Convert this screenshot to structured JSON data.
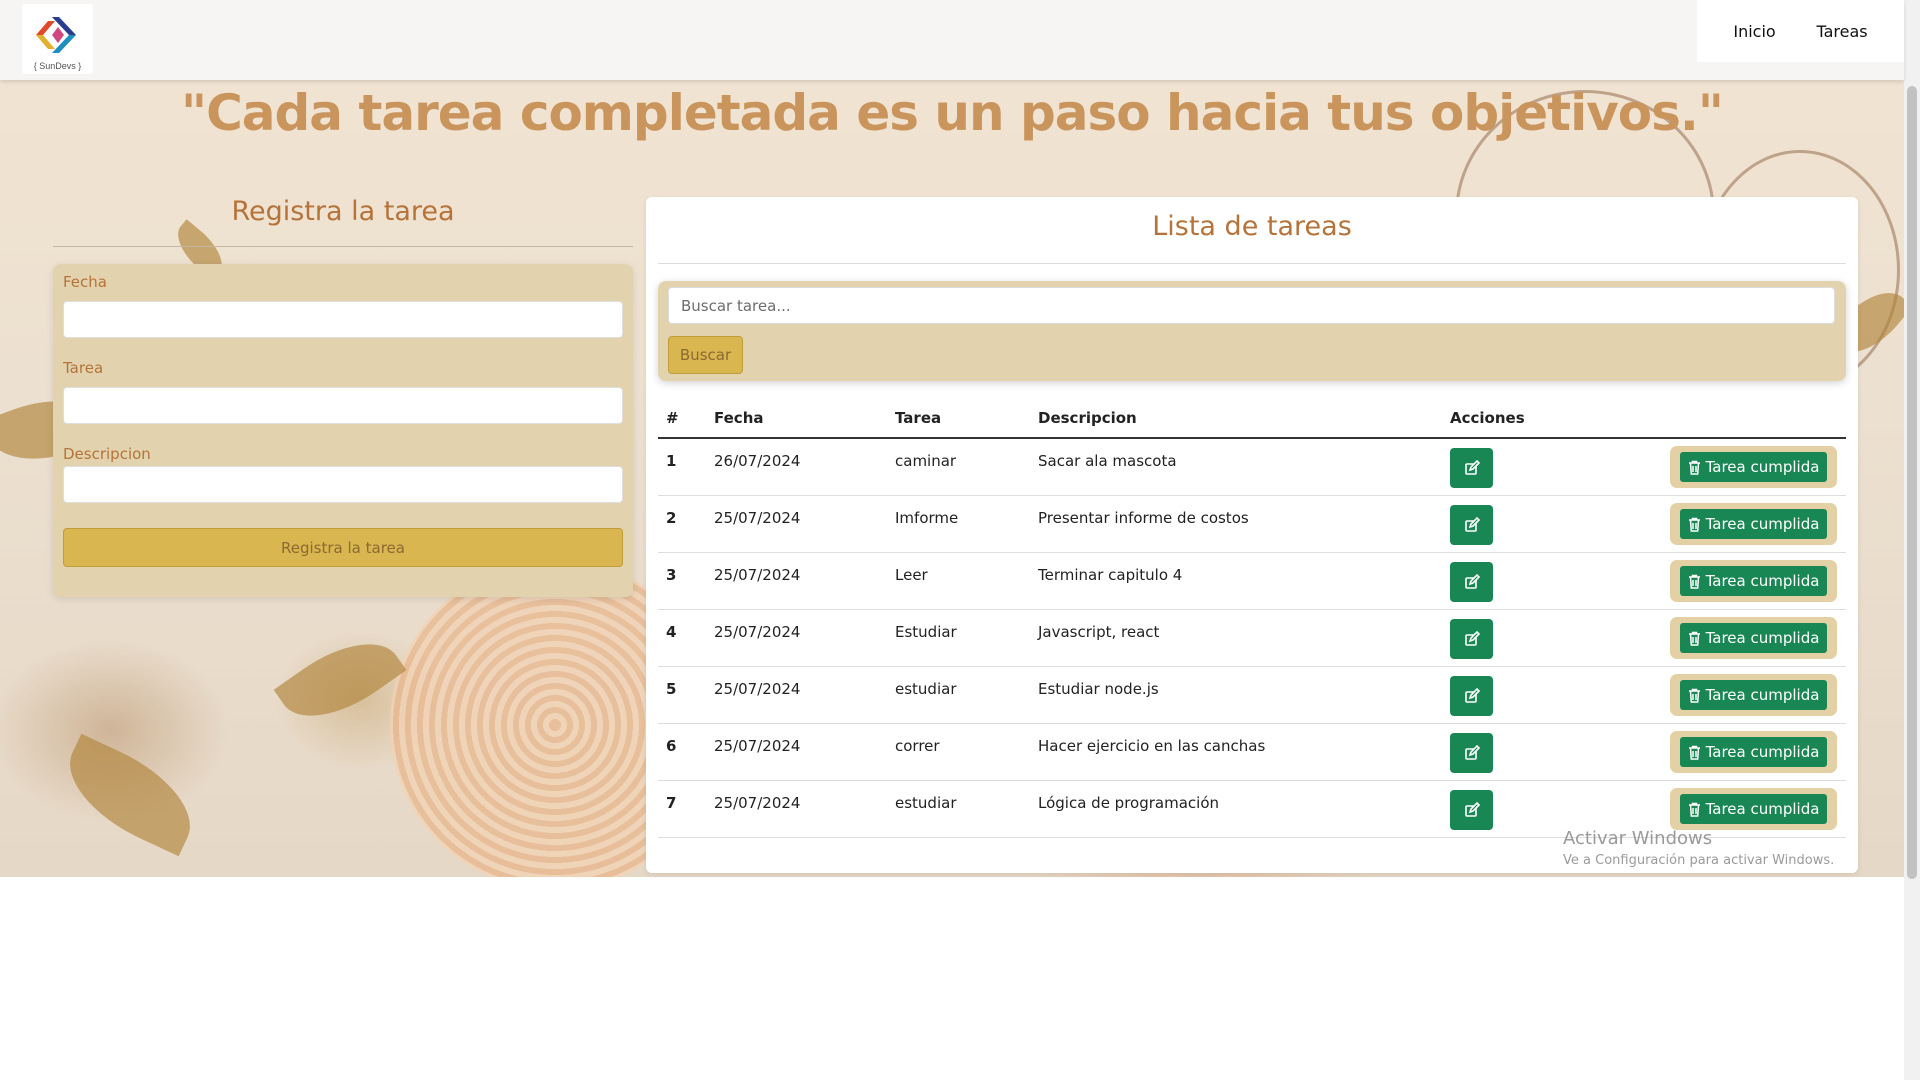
{
  "navbar": {
    "logo_text": "{ SunDevs }",
    "links": [
      "Inicio",
      "Tareas"
    ]
  },
  "hero": {
    "quote": "\"Cada tarea completada es un paso hacia tus objetivos.\""
  },
  "form": {
    "title": "Registra la tarea",
    "fields": [
      {
        "label": "Fecha",
        "value": ""
      },
      {
        "label": "Tarea",
        "value": ""
      },
      {
        "label": "Descripcion",
        "value": ""
      }
    ],
    "submit_label": "Registra la tarea"
  },
  "list": {
    "title": "Lista de tareas",
    "search_placeholder": "Buscar tarea...",
    "search_button": "Buscar",
    "columns": [
      "#",
      "Fecha",
      "Tarea",
      "Descripcion",
      "Acciones"
    ],
    "rows": [
      {
        "num": "1",
        "date": "26/07/2024",
        "task": "caminar",
        "desc": "Sacar ala mascota"
      },
      {
        "num": "2",
        "date": "25/07/2024",
        "task": "Imforme",
        "desc": "Presentar informe de costos"
      },
      {
        "num": "3",
        "date": "25/07/2024",
        "task": "Leer",
        "desc": "Terminar capitulo 4"
      },
      {
        "num": "4",
        "date": "25/07/2024",
        "task": "Estudiar",
        "desc": "Javascript, react"
      },
      {
        "num": "5",
        "date": "25/07/2024",
        "task": "estudiar",
        "desc": "Estudiar node.js"
      },
      {
        "num": "6",
        "date": "25/07/2024",
        "task": "correr",
        "desc": "Hacer ejercicio en las canchas"
      },
      {
        "num": "7",
        "date": "25/07/2024",
        "task": "estudiar",
        "desc": "Lógica de programación"
      }
    ],
    "done_label": "Tarea cumplida",
    "edit_icon": "edit-icon",
    "done_icon": "trash-icon"
  },
  "windows_watermark": {
    "title": "Activar Windows",
    "subtitle": "Ve a Configuración para activar Windows."
  },
  "colors": {
    "accent_text": "#b5733a",
    "quote": "#c9955c",
    "gold_button": "#d9b650",
    "panel": "#e2d3ae",
    "success": "#198754"
  }
}
